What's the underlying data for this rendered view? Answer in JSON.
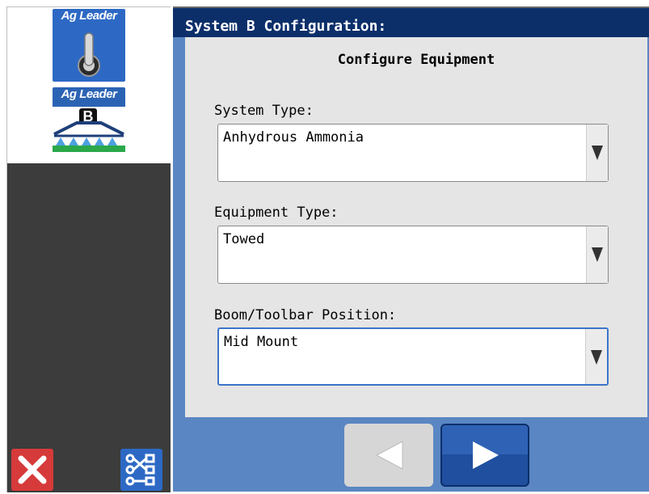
{
  "sidebar": {
    "tiles": [
      {
        "brand": "Ag Leader",
        "icon": "toggle-switch-icon"
      },
      {
        "brand": "Ag Leader",
        "icon": "sprayer-boom-b-icon",
        "badge": "B"
      }
    ],
    "cancel_icon": "close-icon",
    "config_icon": "configuration-tree-icon"
  },
  "header": {
    "title": "System B Configuration:"
  },
  "main": {
    "title": "Configure Equipment",
    "fields": [
      {
        "label": "System Type:",
        "value": "Anhydrous Ammonia"
      },
      {
        "label": "Equipment Type:",
        "value": "Towed"
      },
      {
        "label": "Boom/Toolbar Position:",
        "value": "Mid Mount"
      }
    ]
  },
  "nav": {
    "prev_icon": "triangle-left-icon",
    "next_icon": "triangle-right-icon"
  },
  "colors": {
    "header_bg": "#0c2f6a",
    "panel_bg": "#5a86c3",
    "cancel": "#d63a3a",
    "accent": "#2d69c4"
  }
}
